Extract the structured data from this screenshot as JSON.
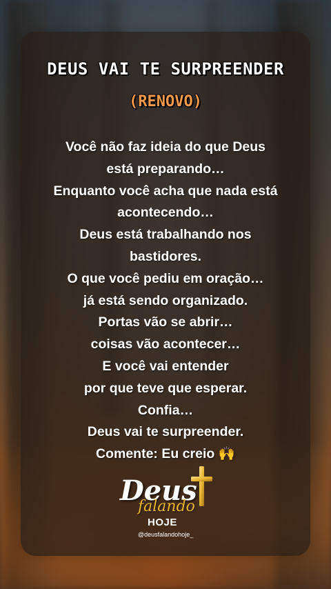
{
  "post": {
    "title": "DEUS VAI TE SURPREENDER",
    "subtitle": "(RENOVO)",
    "lines": [
      "Você não faz ideia do que Deus",
      "está preparando…",
      "Enquanto você acha que nada está",
      "acontecendo…",
      "Deus está trabalhando nos",
      "bastidores.",
      "O que você pediu em oração…",
      "já está sendo organizado.",
      "Portas vão se abrir…",
      "coisas vão acontecer…",
      "E você vai entender",
      "por que teve que esperar.",
      "Confia…",
      "Deus vai te surpreender.",
      "Comente: Eu creio 🙌"
    ]
  },
  "logo": {
    "word1": "Deus",
    "word2": "falando",
    "word3": "HOJE",
    "handle": "@deusfalandohoje_",
    "icon": "cross-icon"
  },
  "colors": {
    "title": "#ffffff",
    "subtitle": "#f2994a",
    "cross": "#e8b530",
    "card": "#281e18"
  }
}
